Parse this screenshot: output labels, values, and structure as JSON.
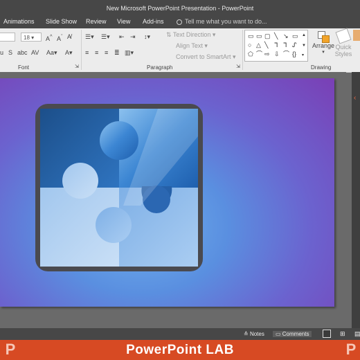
{
  "window": {
    "title": "New Microsoft PowerPoint Presentation - PowerPoint"
  },
  "tabs": [
    "Animations",
    "Slide Show",
    "Review",
    "View",
    "Add-ins"
  ],
  "tell_me": {
    "placeholder": "Tell me what you want to do..."
  },
  "ribbon": {
    "font": {
      "label": "Font",
      "size_value": "18"
    },
    "paragraph": {
      "label": "Paragraph",
      "text_direction": "Text Direction",
      "align_text": "Align Text",
      "convert_smartart": "Convert to SmartArt"
    },
    "drawing": {
      "label": "Drawing",
      "arrange": "Arrange",
      "quick_styles_1": "Quick",
      "quick_styles_2": "Styles"
    }
  },
  "status": {
    "notes": "Notes",
    "comments": "Comments"
  },
  "banner": {
    "text": "PowerPoint LAB",
    "logo_left": "P",
    "logo_right": "P"
  },
  "colors": {
    "banner": "#d74a23",
    "chrome": "#474747",
    "ribbon": "#ececec"
  }
}
